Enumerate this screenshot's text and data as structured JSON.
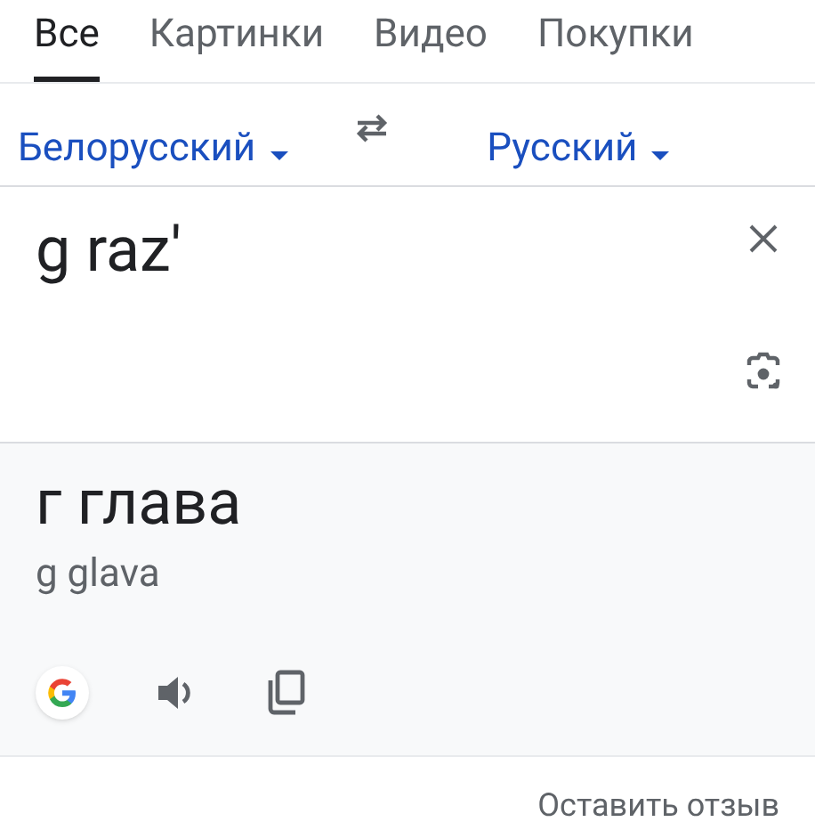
{
  "tabs": [
    {
      "label": "Все",
      "selected": true
    },
    {
      "label": "Картинки",
      "selected": false
    },
    {
      "label": "Видео",
      "selected": false
    },
    {
      "label": "Покупки",
      "selected": false
    }
  ],
  "translator": {
    "source_language": "Белорусский",
    "target_language": "Русский",
    "input": "g raz'",
    "translation": "г глава",
    "transliteration": "g glava"
  },
  "feedback_link": "Оставить отзыв"
}
